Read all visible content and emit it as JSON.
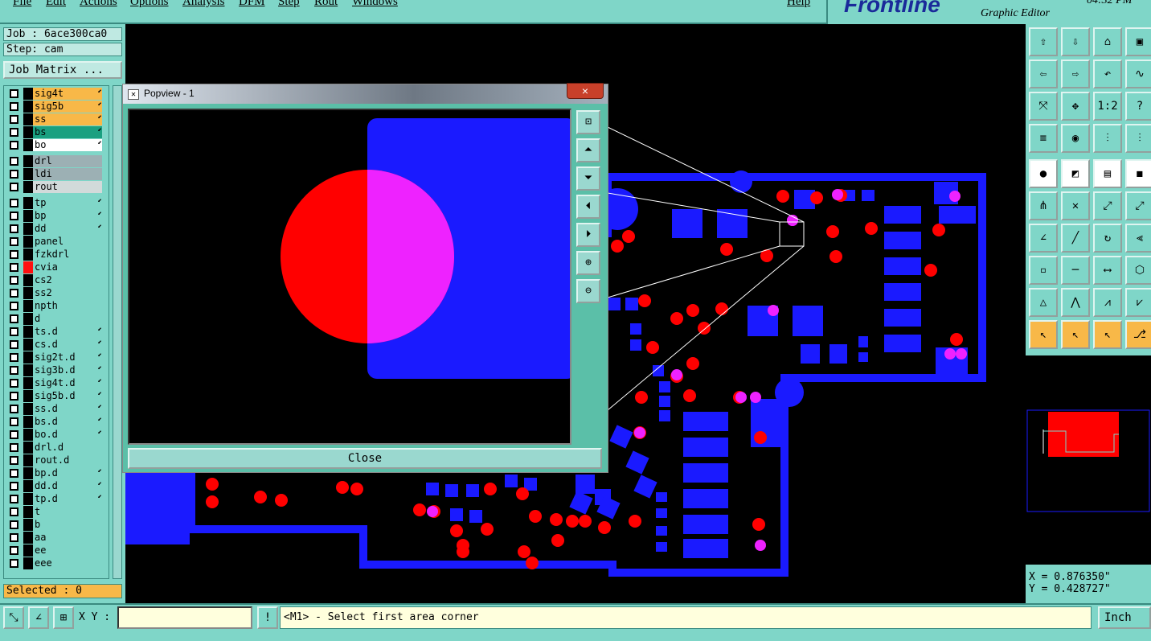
{
  "menubar": {
    "items": [
      "File",
      "Edit",
      "Actions",
      "Options",
      "Analysis",
      "DFM",
      "Step",
      "Rout",
      "Windows"
    ],
    "help": "Help"
  },
  "brand": {
    "logo": "Frontline",
    "subtitle": "Graphic Editor",
    "clock": "04:32 PM"
  },
  "job": {
    "job_line": "Job : 6ace300ca0",
    "step_line": "Step: cam",
    "matrix_button": "Job Matrix ..."
  },
  "layers": [
    {
      "name": "sig4t",
      "style": "sel-y",
      "flag": "⬋"
    },
    {
      "name": "sig5b",
      "style": "sel-y",
      "flag": "⬋"
    },
    {
      "name": "ss",
      "style": "sel-y",
      "flag": "⬋"
    },
    {
      "name": "bs",
      "style": "sel-g",
      "flag": "⬋"
    },
    {
      "name": "bo",
      "style": "white",
      "flag": "⬋"
    },
    {
      "name": "drl",
      "style": "gray",
      "flag": ""
    },
    {
      "name": "ldi",
      "style": "gray",
      "flag": ""
    },
    {
      "name": "rout",
      "style": "lgray",
      "flag": ""
    },
    {
      "name": "tp",
      "style": "",
      "flag": "⬋"
    },
    {
      "name": "bp",
      "style": "",
      "flag": "⬋"
    },
    {
      "name": "dd",
      "style": "",
      "flag": "⬋"
    },
    {
      "name": "panel",
      "style": "",
      "flag": ""
    },
    {
      "name": "fzkdrl",
      "style": "",
      "flag": ""
    },
    {
      "name": "cvia",
      "style": "",
      "flag": "",
      "color": "#ff1010"
    },
    {
      "name": "cs2",
      "style": "",
      "flag": ""
    },
    {
      "name": "ss2",
      "style": "",
      "flag": ""
    },
    {
      "name": "npth",
      "style": "",
      "flag": ""
    },
    {
      "name": "d",
      "style": "",
      "flag": ""
    },
    {
      "name": "ts.d",
      "style": "",
      "flag": "⬋"
    },
    {
      "name": "cs.d",
      "style": "",
      "flag": "⬋"
    },
    {
      "name": "sig2t.d",
      "style": "",
      "flag": "⬋"
    },
    {
      "name": "sig3b.d",
      "style": "",
      "flag": "⬋"
    },
    {
      "name": "sig4t.d",
      "style": "",
      "flag": "⬋"
    },
    {
      "name": "sig5b.d",
      "style": "",
      "flag": "⬋"
    },
    {
      "name": "ss.d",
      "style": "",
      "flag": "⬋"
    },
    {
      "name": "bs.d",
      "style": "",
      "flag": "⬋"
    },
    {
      "name": "bo.d",
      "style": "",
      "flag": "⬋"
    },
    {
      "name": "drl.d",
      "style": "",
      "flag": ""
    },
    {
      "name": "rout.d",
      "style": "",
      "flag": ""
    },
    {
      "name": "bp.d",
      "style": "",
      "flag": "⬋"
    },
    {
      "name": "dd.d",
      "style": "",
      "flag": "⬋"
    },
    {
      "name": "tp.d",
      "style": "",
      "flag": "⬋"
    },
    {
      "name": "t",
      "style": "",
      "flag": ""
    },
    {
      "name": "b",
      "style": "",
      "flag": ""
    },
    {
      "name": "aa",
      "style": "",
      "flag": ""
    },
    {
      "name": "ee",
      "style": "",
      "flag": ""
    },
    {
      "name": "eee",
      "style": "",
      "flag": ""
    }
  ],
  "selected": "Selected : 0",
  "popview": {
    "title": "Popview - 1",
    "close_label": "Close",
    "close_x": "×"
  },
  "coords": {
    "x": "X = 0.876350\"",
    "y": "Y = 0.428727\""
  },
  "status": {
    "xy_label": "X Y :",
    "xy_value": "",
    "prompt": "<M1> - Select first area corner",
    "units": "Inch"
  },
  "colors": {
    "pad": "#1a1aff",
    "via": "#ff0000",
    "overlap": "#ee22ff",
    "ui": "#7fd6c8",
    "highlight": "#f8b848"
  }
}
